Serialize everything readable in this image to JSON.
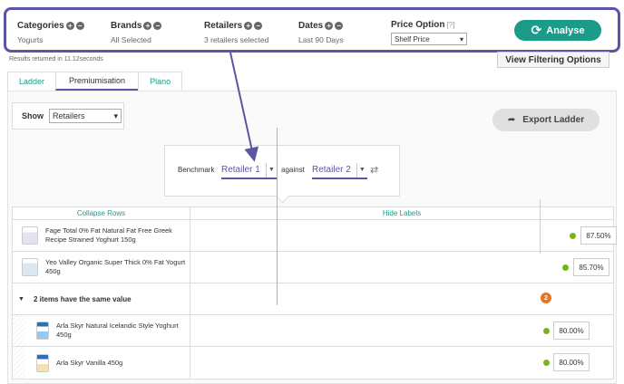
{
  "filters": {
    "categories": {
      "title": "Categories",
      "value": "Yogurts"
    },
    "brands": {
      "title": "Brands",
      "value": "All Selected"
    },
    "retailers": {
      "title": "Retailers",
      "value": "3 retailers selected"
    },
    "dates": {
      "title": "Dates",
      "value": "Last 90 Days"
    },
    "price_option": {
      "title": "Price Option",
      "hint": "[?]",
      "value": "Shelf Price"
    },
    "analyse_label": "Analyse"
  },
  "results_text": "Results returned in 11.12seconds",
  "view_filtering_label": "View Filtering Options",
  "tabs": [
    {
      "label": "Ladder"
    },
    {
      "label": "Premiumisation"
    },
    {
      "label": "Plano"
    }
  ],
  "show": {
    "label": "Show",
    "value": "Retailers"
  },
  "export_label": "Export Ladder",
  "benchmark": {
    "label": "Benchmark",
    "against_label": "against",
    "retailer1": "Retailer 1",
    "retailer2": "Retailer 2"
  },
  "ladder": {
    "collapse_label": "Collapse Rows",
    "hide_labels": "Hide Labels",
    "rows": [
      {
        "name": "Fage Total 0% Fat Natural Fat Free Greek Recipe Strained Yoghurt 150g",
        "value": "87.50%"
      },
      {
        "name": "Yeo Valley Organic Super Thick 0% Fat Yogurt 450g",
        "value": "85.70%"
      },
      {
        "group": "2 items have the same value",
        "count": "2"
      },
      {
        "name": "Arla Skyr Natural Icelandic Style Yoghurt 450g",
        "value": "80.00%"
      },
      {
        "name": "Arla Skyr Vanilla 450g",
        "value": "80.00%"
      }
    ]
  },
  "colors": {
    "accent": "#1a9c88",
    "highlight": "#5b56a3",
    "marker": "#7ab317",
    "badge": "#e9741f"
  }
}
